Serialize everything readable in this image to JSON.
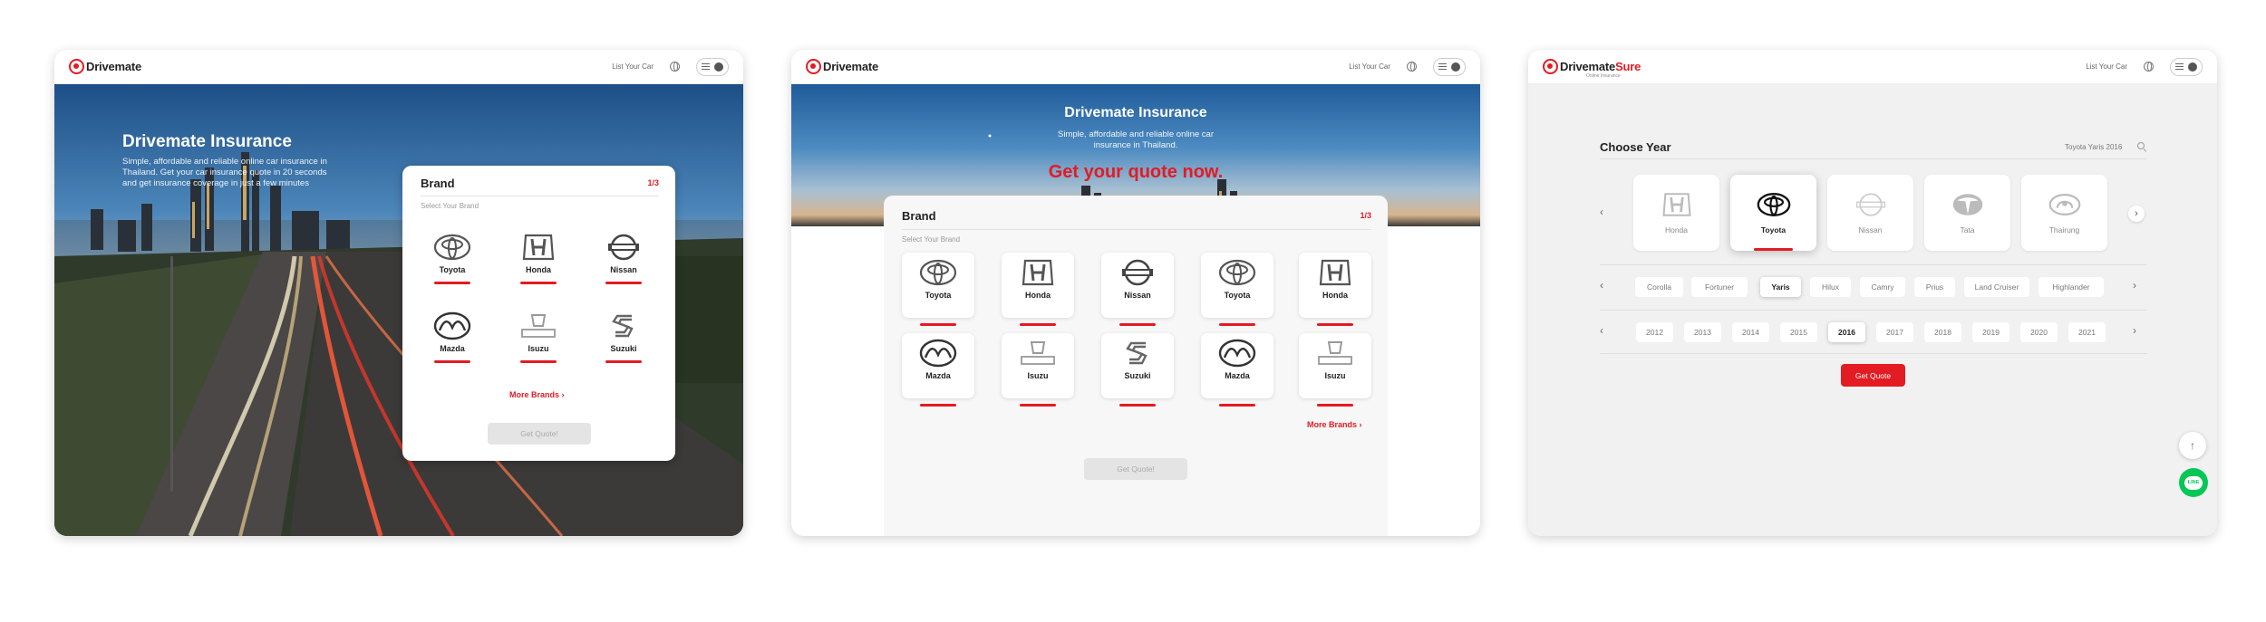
{
  "colors": {
    "accent": "#e31b23",
    "line_green": "#06c755"
  },
  "nav": {
    "logo_text": "Drivemate",
    "logo_text_sure": "Sure",
    "logo_sub": "Online Insurance",
    "list_your_car": "List Your Car"
  },
  "screen1": {
    "hero_title": "Drivemate Insurance",
    "hero_sub": "Simple, affordable and reliable online car insurance in Thailand. Get your car insurance quote in 20 seconds and get insurance coverage in just a few minutes",
    "card_title": "Brand",
    "step": "1/3",
    "hint": "Select Your Brand",
    "brands": [
      "Toyota",
      "Honda",
      "Nissan",
      "Mazda",
      "Isuzu",
      "Suzuki"
    ],
    "more": "More Brands",
    "quote": "Get Quote!"
  },
  "screen2": {
    "hero_title": "Drivemate Insurance",
    "hero_sub": "Simple, affordable and reliable online car insurance in Thailand.",
    "cta": "Get your quote now.",
    "card_title": "Brand",
    "step": "1/3",
    "hint": "Select Your Brand",
    "brands": [
      "Toyota",
      "Honda",
      "Nissan",
      "Toyota",
      "Honda",
      "Mazda",
      "Isuzu",
      "Suzuki",
      "Mazda",
      "Isuzu"
    ],
    "more": "More Brands",
    "quote": "Get Quote!"
  },
  "screen3": {
    "title": "Choose Year",
    "search_value": "Toyota Yaris 2016",
    "brands": [
      "Honda",
      "Toyota",
      "Nissan",
      "Tata",
      "Thairung"
    ],
    "selected_brand": "Toyota",
    "models": [
      "Corolla",
      "Fortuner",
      "Yaris",
      "Hilux",
      "Camry",
      "Prius",
      "Land Cruiser",
      "Highlander"
    ],
    "selected_model": "Yaris",
    "years": [
      "2012",
      "2013",
      "2014",
      "2015",
      "2016",
      "2017",
      "2018",
      "2019",
      "2020",
      "2021"
    ],
    "selected_year": "2016",
    "quote": "Get Quote",
    "line_label": "LINE"
  }
}
